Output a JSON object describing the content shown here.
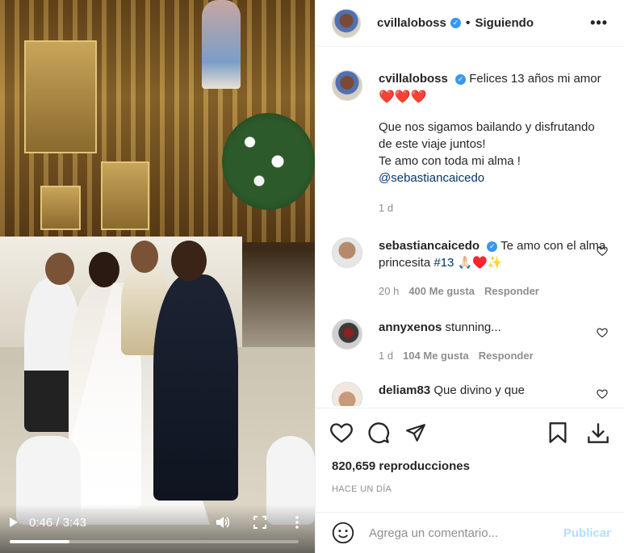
{
  "video": {
    "current_time": "0:46",
    "duration": "3:43",
    "time_separator": " / ",
    "progress_fraction": 0.206
  },
  "post": {
    "owner": "cvillaloboss",
    "follow_state": "Siguiendo",
    "more_label": "•••",
    "views": "820,659 reproducciones",
    "time_ago": "HACE UN DÍA"
  },
  "caption": {
    "username": "cvillaloboss",
    "line1": "Felices 13 años mi amor",
    "hearts": "❤️❤️❤️",
    "line2": "Que nos sigamos bailando y disfrutando de este viaje juntos!",
    "line3": "Te amo con toda mi alma !",
    "mention": "@sebastiancaicedo",
    "age": "1 d"
  },
  "comments": [
    {
      "username": "sebastiancaicedo",
      "text": "Te amo con el alma princesita",
      "hashtag": "#13",
      "emojis": "🙏🏻♥️✨",
      "age": "20 h",
      "likes": "400 Me gusta",
      "reply": "Responder"
    },
    {
      "username": "annyxenos",
      "text": "stunning...",
      "age": "1 d",
      "likes": "104 Me gusta",
      "reply": "Responder"
    },
    {
      "username": "deliam83",
      "text": "Que divino y que"
    }
  ],
  "add_comment": {
    "placeholder": "Agrega un comentario...",
    "publish": "Publicar"
  },
  "colors": {
    "verified": "#3897f0",
    "link": "#00376b",
    "publish_disabled": "#b2dffc",
    "heart": "#ed4956"
  }
}
